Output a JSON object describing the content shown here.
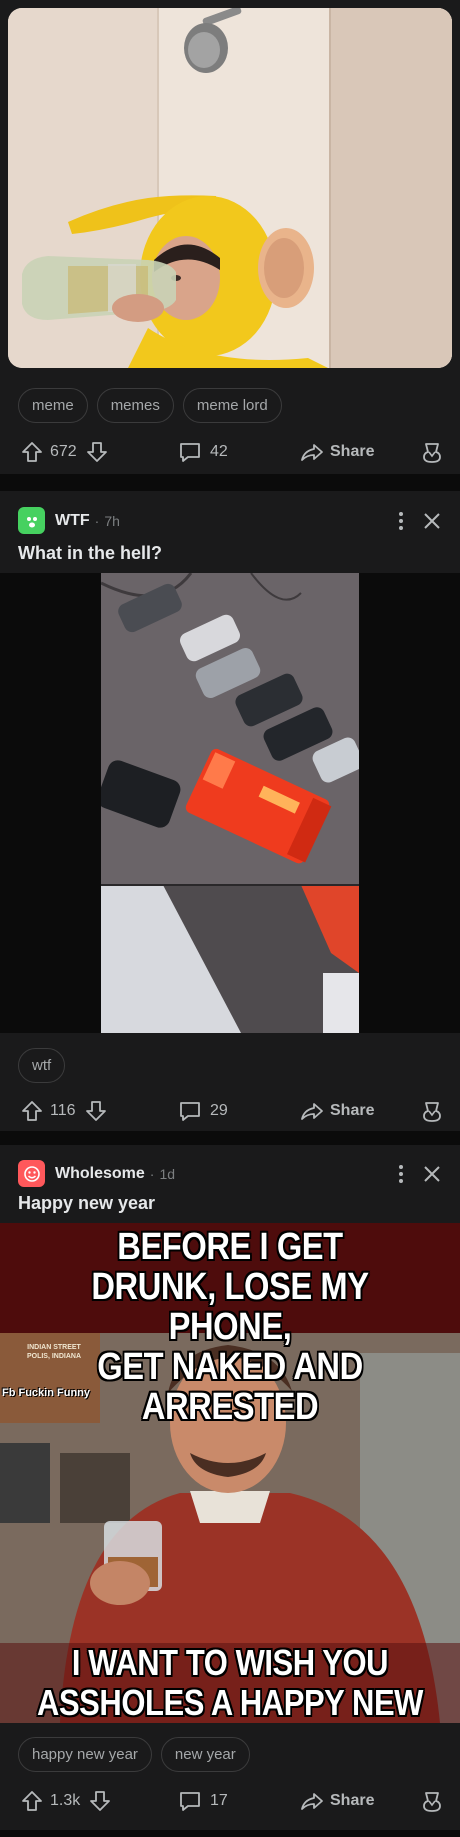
{
  "posts": [
    {
      "tags": [
        "meme",
        "memes",
        "meme lord"
      ],
      "votes": "672",
      "comments": "42",
      "share_label": "Share"
    },
    {
      "subreddit": "WTF",
      "time": "7h",
      "title": "What in the hell?",
      "icon_color": "#46d160",
      "tags": [
        "wtf"
      ],
      "votes": "116",
      "comments": "29",
      "share_label": "Share"
    },
    {
      "subreddit": "Wholesome",
      "time": "1d",
      "title": "Happy new year",
      "icon_color": "#ff585b",
      "meme_top": [
        "BEFORE I GET",
        "DRUNK, LOSE MY PHONE,",
        "GET NAKED AND ARRESTED"
      ],
      "meme_bottom": [
        "I WANT TO WISH YOU",
        "ASSHOLES A HAPPY NEW YEAR"
      ],
      "watermark": "Fb Fuckin Funny",
      "sign_text": [
        "INDIAN STREET",
        "POLIS, INDIANA"
      ],
      "tags": [
        "happy new year",
        "new year"
      ],
      "votes": "1.3k",
      "comments": "17",
      "share_label": "Share"
    }
  ],
  "icons": {
    "upvote": "upvote-icon",
    "downvote": "downvote-icon",
    "comment": "comment-icon",
    "share": "share-icon",
    "award": "award-icon",
    "more": "more-options-icon",
    "close": "close-icon"
  }
}
